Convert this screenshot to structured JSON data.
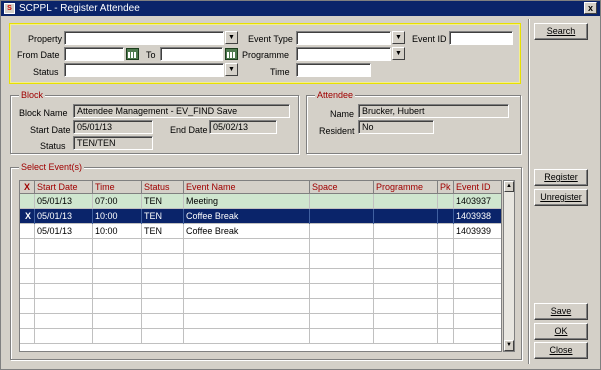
{
  "window": {
    "title": "SCPPL - Register Attendee",
    "close_glyph": "x",
    "app_icon": "scp-app-icon"
  },
  "search": {
    "property_label": "Property",
    "from_date_label": "From Date",
    "to_label": "To",
    "status_label": "Status",
    "event_type_label": "Event Type",
    "programme_label": "Programme",
    "time_label": "Time",
    "event_id_label": "Event ID",
    "property_value": "",
    "from_date_value": "",
    "to_value": "",
    "status_value": "",
    "event_type_value": "",
    "programme_value": "",
    "time_value": "",
    "event_id_value": ""
  },
  "block": {
    "group_title": "Block",
    "block_name_label": "Block Name",
    "block_name_value": "Attendee Management - EV_FIND Save",
    "start_date_label": "Start Date",
    "start_date_value": "05/01/13",
    "end_date_label": "End Date",
    "end_date_value": "05/02/13",
    "status_label": "Status",
    "status_value": "TEN/TEN"
  },
  "attendee": {
    "group_title": "Attendee",
    "name_label": "Name",
    "name_value": "Brucker, Hubert",
    "resident_label": "Resident",
    "resident_value": "No"
  },
  "events": {
    "group_title": "Select Event(s)",
    "columns": [
      "X",
      "Start Date",
      "Time",
      "Status",
      "Event Name",
      "Space",
      "Programme",
      "Pk",
      "Event ID"
    ],
    "rows": [
      {
        "x": "",
        "start_date": "05/01/13",
        "time": "07:00",
        "status": "TEN",
        "event_name": "Meeting",
        "space": "",
        "programme": "",
        "pk": "",
        "event_id": "1403937"
      },
      {
        "x": "X",
        "start_date": "05/01/13",
        "time": "10:00",
        "status": "TEN",
        "event_name": "Coffee Break",
        "space": "",
        "programme": "",
        "pk": "",
        "event_id": "1403938"
      },
      {
        "x": "",
        "start_date": "05/01/13",
        "time": "10:00",
        "status": "TEN",
        "event_name": "Coffee Break",
        "space": "",
        "programme": "",
        "pk": "",
        "event_id": "1403939"
      }
    ]
  },
  "buttons": {
    "search": "Search",
    "register": "Register",
    "unregister": "Unregister",
    "save": "Save",
    "ok": "OK",
    "close": "Close"
  },
  "colors": {
    "title_bar": "#0a246a",
    "selected_row": "#0a246a",
    "highlight_row": "#cfe6cf",
    "search_border": "#e8e000",
    "label_accent": "#a00000"
  }
}
